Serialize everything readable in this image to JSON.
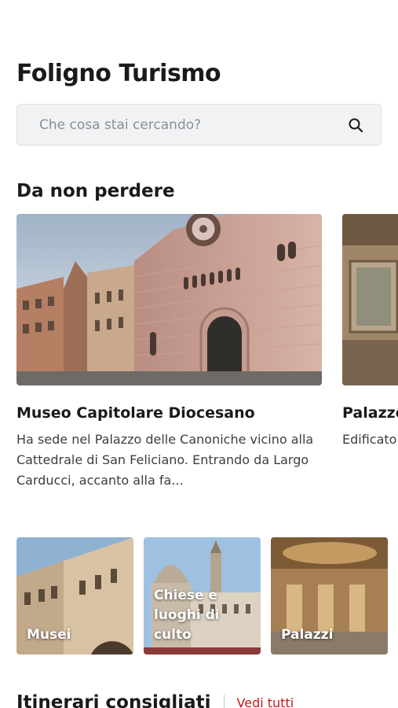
{
  "header": {
    "title": "Foligno Turismo"
  },
  "search": {
    "placeholder": "Che cosa stai cercando?"
  },
  "highlights": {
    "title": "Da non perdere",
    "cards": [
      {
        "title": "Museo Capitolare Diocesano",
        "description": "Ha sede nel Palazzo delle Canoniche vicino alla Cattedrale di San Feliciano. Entrando da Largo Carducci, accanto alla fa..."
      },
      {
        "title": "Palazzo Trinci - Quintana",
        "description": "Edificato ... divenne ... oggi app..."
      }
    ]
  },
  "categories": [
    {
      "label": "Musei"
    },
    {
      "label": "Chiese e luoghi di culto"
    },
    {
      "label": "Palazzi"
    }
  ],
  "itineraries": {
    "title": "Itinerari consigliati",
    "see_all": "Vedi tutti"
  },
  "colors": {
    "accent": "#c21a1a",
    "search_bg": "#f1f2f4"
  }
}
